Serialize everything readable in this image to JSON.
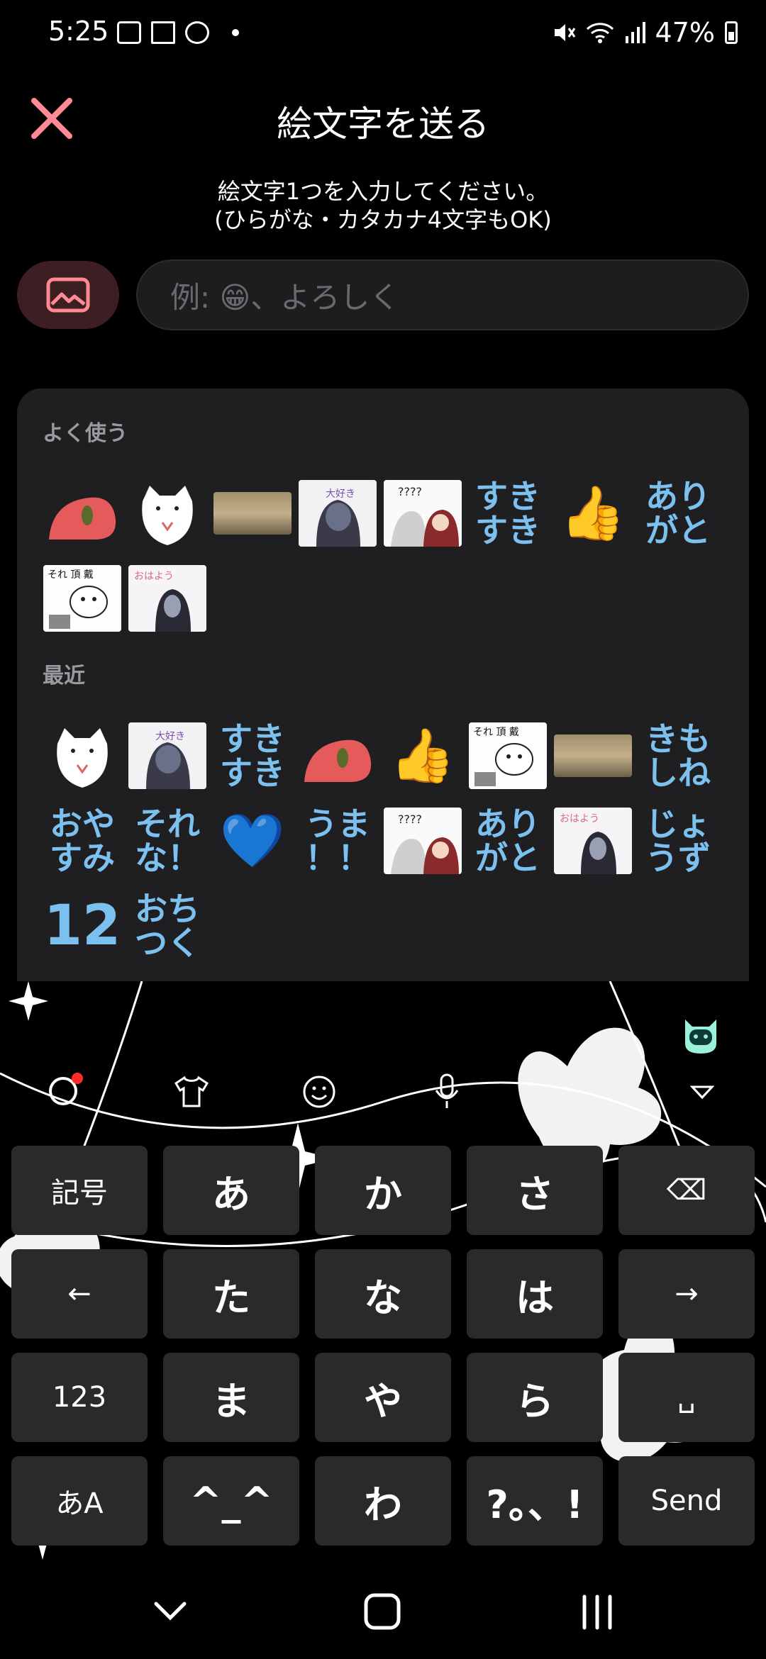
{
  "status_bar": {
    "time": "5:25",
    "battery": "47%"
  },
  "header": {
    "title": "絵文字を送る",
    "subtitle_line1": "絵文字1つを入力してください。",
    "subtitle_line2": "(ひらがな・カタカナ4文字もOK)"
  },
  "input": {
    "placeholder": "例: 😁、よろしく"
  },
  "sections": {
    "frequent_label": "よく使う",
    "recent_label": "最近"
  },
  "frequent": [
    {
      "kind": "sticker",
      "icon": "red-bird-sticker"
    },
    {
      "kind": "sticker",
      "icon": "white-cat-sticker"
    },
    {
      "kind": "sticker",
      "icon": "sky-photo-sticker"
    },
    {
      "kind": "sticker",
      "icon": "anime-girl-sticker"
    },
    {
      "kind": "sticker",
      "icon": "manga-panel-sticker"
    },
    {
      "kind": "text",
      "line1": "すき",
      "line2": "すき"
    },
    {
      "kind": "emoji",
      "text": "👍"
    },
    {
      "kind": "text",
      "line1": "あり",
      "line2": "がと"
    },
    {
      "kind": "sticker",
      "icon": "sore-choudai-sticker"
    },
    {
      "kind": "sticker",
      "icon": "ohayou-sticker"
    }
  ],
  "recent": [
    {
      "kind": "sticker",
      "icon": "white-cat-sticker"
    },
    {
      "kind": "sticker",
      "icon": "anime-girl-sticker"
    },
    {
      "kind": "text",
      "line1": "すき",
      "line2": "すき"
    },
    {
      "kind": "sticker",
      "icon": "red-bird-sticker"
    },
    {
      "kind": "emoji",
      "text": "👍"
    },
    {
      "kind": "sticker",
      "icon": "sore-choudai-sticker"
    },
    {
      "kind": "sticker",
      "icon": "sky-photo-sticker"
    },
    {
      "kind": "text",
      "line1": "きも",
      "line2": "しね"
    },
    {
      "kind": "text",
      "line1": "おや",
      "line2": "すみ"
    },
    {
      "kind": "text",
      "line1": "それ",
      "line2": "な！"
    },
    {
      "kind": "emoji",
      "text": "💙"
    },
    {
      "kind": "text",
      "line1": "うま",
      "line2": "！！"
    },
    {
      "kind": "sticker",
      "icon": "manga-panel-sticker"
    },
    {
      "kind": "text",
      "line1": "あり",
      "line2": "がと"
    },
    {
      "kind": "sticker",
      "icon": "ohayou-sticker"
    },
    {
      "kind": "text",
      "line1": "じょ",
      "line2": "うず"
    },
    {
      "kind": "big",
      "text": "12"
    },
    {
      "kind": "text",
      "line1": "おち",
      "line2": "つく"
    }
  ],
  "keyboard": {
    "rows": [
      [
        "記号",
        "あ",
        "か",
        "さ",
        "⌫"
      ],
      [
        "←",
        "た",
        "な",
        "は",
        "→"
      ],
      [
        "123",
        "ま",
        "や",
        "ら",
        "␣"
      ],
      [
        "あA",
        "^_^",
        "わ",
        "?。、!",
        "Send"
      ]
    ]
  },
  "colors": {
    "accent": "#7cc0f0",
    "close": "#ff8a93",
    "panel": "#1f1f21"
  }
}
